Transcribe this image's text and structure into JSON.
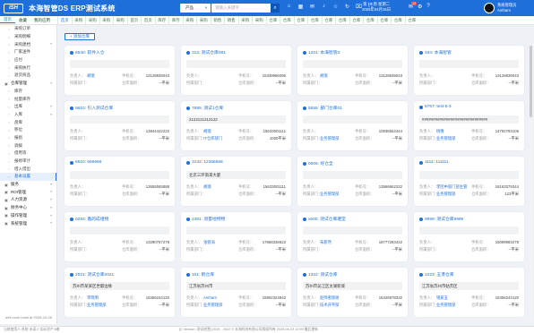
{
  "header": {
    "logo": "ISH",
    "title": "本海智管DS ERP测试系统",
    "product_select": "产品",
    "search_placeholder": "请输入关键字",
    "date_line1": "第 16 周 星期二",
    "date_line2": "2025年04月15日",
    "notif_count": "12",
    "user_name": "系统管理员",
    "user_sub": "Antharn"
  },
  "nav": {
    "items": [
      "首页",
      "收藏",
      "我的应用"
    ]
  },
  "tabs": [
    "首页",
    "采购",
    "采购",
    "采购",
    "采购",
    "首页",
    "首页",
    "库存",
    "库存",
    "采购",
    "采购",
    "销售",
    "销售",
    "采购",
    "采购",
    "仓库",
    "仓库",
    "仓库",
    "仓库",
    "仓库",
    "仓库",
    "仓库",
    "仓库",
    "仓库",
    "仓库",
    "仓库"
  ],
  "sidebar": {
    "items": [
      {
        "label": "采购订单",
        "type": "sub",
        "icon": "doc-icon"
      },
      {
        "label": "采购明细",
        "type": "sub",
        "icon": "doc-icon"
      },
      {
        "label": "采购建档",
        "type": "sub",
        "icon": "doc-icon",
        "arrow": true
      },
      {
        "label": "厂家送件",
        "type": "sub",
        "icon": "doc-icon"
      },
      {
        "label": "应付",
        "type": "sub",
        "icon": "doc-icon"
      },
      {
        "label": "采购执行",
        "type": "sub",
        "icon": "doc-icon"
      },
      {
        "label": "退货商品",
        "type": "sub",
        "icon": "doc-icon"
      },
      {
        "label": "仓库管理",
        "type": "group",
        "icon": "warehouse-icon",
        "arrow": true
      },
      {
        "label": "库存",
        "type": "sub",
        "icon": "doc-icon"
      },
      {
        "label": "批量库存",
        "type": "sub",
        "icon": "doc-icon"
      },
      {
        "label": "出库",
        "type": "sub",
        "icon": "doc-icon",
        "arrow": true
      },
      {
        "label": "入库",
        "type": "sub",
        "icon": "doc-icon",
        "arrow": true
      },
      {
        "label": "盘库",
        "type": "sub",
        "icon": "doc-icon"
      },
      {
        "label": "移位",
        "type": "sub",
        "icon": "doc-icon"
      },
      {
        "label": "报损",
        "type": "sub",
        "icon": "doc-icon"
      },
      {
        "label": "调拨",
        "type": "sub",
        "icon": "doc-icon"
      },
      {
        "label": "借用等",
        "type": "sub",
        "icon": "doc-icon"
      },
      {
        "label": "报修审计",
        "type": "sub",
        "icon": "doc-icon"
      },
      {
        "label": "借入借出",
        "type": "sub",
        "icon": "doc-icon"
      },
      {
        "label": "基本设置",
        "type": "sub",
        "icon": "doc-icon",
        "active": true
      },
      {
        "label": "服务",
        "type": "group",
        "icon": "service-icon",
        "arrow": true
      },
      {
        "label": "ROI管理",
        "type": "group",
        "icon": "chart-icon",
        "arrow": true
      },
      {
        "label": "人力资源",
        "type": "group",
        "icon": "people-icon",
        "arrow": true
      },
      {
        "label": "财务中心",
        "type": "group",
        "icon": "money-icon",
        "arrow": true
      },
      {
        "label": "操作管理",
        "type": "group",
        "icon": "gear-icon",
        "arrow": true
      },
      {
        "label": "系统管理",
        "type": "group",
        "icon": "system-icon",
        "arrow": true
      }
    ],
    "footer": "ierih.com build at 2025-04-28"
  },
  "add_button": "+ 添加仓库",
  "labels": {
    "manager": "负责人：",
    "dept": "所属部门：",
    "phone": "手机号：",
    "area": "仓库面积："
  },
  "cards": [
    {
      "title": "6640: 软件入仓",
      "addr": "",
      "manager": "胡瑞",
      "phone": "13128839043",
      "dept": "",
      "area": "--平米"
    },
    {
      "title": "312: 测试仓库081",
      "addr": "",
      "manager": "",
      "phone": "15339986096",
      "dept": "",
      "area": "--平米"
    },
    {
      "title": "1201: 本海智管3",
      "addr": "",
      "manager": "胡瑞",
      "phone": "13128839043",
      "dept": "",
      "area": "--平米"
    },
    {
      "title": "334: 本海智管",
      "addr": "",
      "manager": "",
      "phone": "13128839043",
      "dept": "",
      "area": "--平米"
    },
    {
      "title": "6610: 引入测试仓库",
      "addr": "",
      "manager": "",
      "phone": "13844442222",
      "dept": "",
      "area": "--平米"
    },
    {
      "title": "7695: 测试1仓库",
      "addr": "2122121212122",
      "manager": "胡瑞",
      "phone": "15633001111",
      "dept": "IT仓库部门",
      "area": "1000平米"
    },
    {
      "title": "5555: 部门仓库01",
      "addr": "",
      "manager": "",
      "phone": "10835554444",
      "dept": "业务管理部",
      "area": "--平米"
    },
    {
      "title": "5767: test-5-3",
      "addr": "##############################",
      "manager": "杨倩",
      "phone": "14792793106",
      "dept": "业务管理部",
      "area": "--平米"
    },
    {
      "title": "6610: 666666",
      "addr": "",
      "manager": "",
      "phone": "13655555888",
      "dept": "",
      "area": "--平米"
    },
    {
      "title": "3132: 12366668",
      "addr": "北京三环南来大厦",
      "manager": "胡瑞",
      "phone": "15633001111",
      "dept": "",
      "area": "--平米"
    },
    {
      "title": "0006: 好仓全",
      "addr": "",
      "manager": "",
      "phone": "13566662222",
      "dept": "业务管理部",
      "area": "--平米"
    },
    {
      "title": "1111: 111111",
      "addr": "",
      "manager": "李团中部门部主管",
      "phone": "18163379344",
      "dept": "业务管理部",
      "area": "123平米"
    },
    {
      "title": "0293: 鑫的成组物",
      "addr": "",
      "manager": "",
      "phone": "13290767278",
      "dept": "",
      "area": "--平米"
    },
    {
      "title": "2381: 测量地特物",
      "addr": "",
      "manager": "张锐海",
      "phone": "17668336622",
      "dept": "",
      "area": "--平米"
    },
    {
      "title": "x600: 测试仓库堪堂",
      "addr": "",
      "manager": "朱新然",
      "phone": "18777283422",
      "dept": "",
      "area": "--平米"
    },
    {
      "title": "9999: 测试仓库9999",
      "addr": "",
      "manager": "",
      "phone": "15099983278",
      "dept": "",
      "area": "--平米"
    },
    {
      "title": "2021: 测试仓库2021",
      "addr": "苏州市某某区世都边缘",
      "manager": "李晓明",
      "phone": "15356244120",
      "dept": "业务管理部",
      "area": "--平米"
    },
    {
      "title": "101: 鹤仓库",
      "addr": "江苏省苏州市",
      "manager": "Antharn",
      "phone": "15902324942",
      "dept": "业务管理部",
      "area": "--平米"
    },
    {
      "title": "1322: 测试仓库",
      "addr": "苏州市吴江区太湖新城",
      "manager": "赵师者接收",
      "phone": "15426978332",
      "dept": "技术开平部",
      "area": "--平米"
    },
    {
      "title": "1223: 五港仓库",
      "addr": "江苏省苏州市姑苏区",
      "manager": "钱爱五",
      "phone": "15356244120",
      "dept": "业务管理部",
      "area": "--平米"
    }
  ],
  "status": {
    "left": "当前使用人:系统  未读:2  实际资产:8套",
    "center": "[C Version: 测试经营]  2019 - 2022 © 本海科技有限公司版权所有 2025-04-23 12:59 最后更新"
  }
}
